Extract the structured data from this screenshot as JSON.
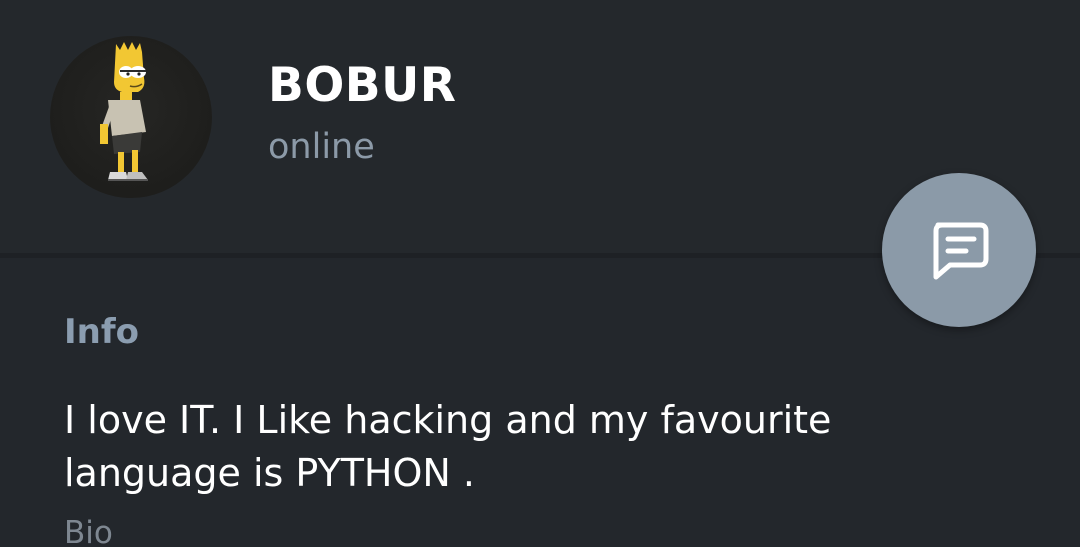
{
  "profile": {
    "name": "BOBUR",
    "status": "online",
    "avatar_icon": "cartoon-character-avatar"
  },
  "fab": {
    "icon": "message-icon"
  },
  "info": {
    "title": "Info",
    "bio_text": "I love IT. I Like hacking and my favourite language is PYTHON .",
    "bio_label": "Bio"
  },
  "colors": {
    "background": "#23272c",
    "name_text": "#ffffff",
    "status_text": "#8c9aa8",
    "section_title": "#8b9db0",
    "fab": "#8b9aa8"
  }
}
